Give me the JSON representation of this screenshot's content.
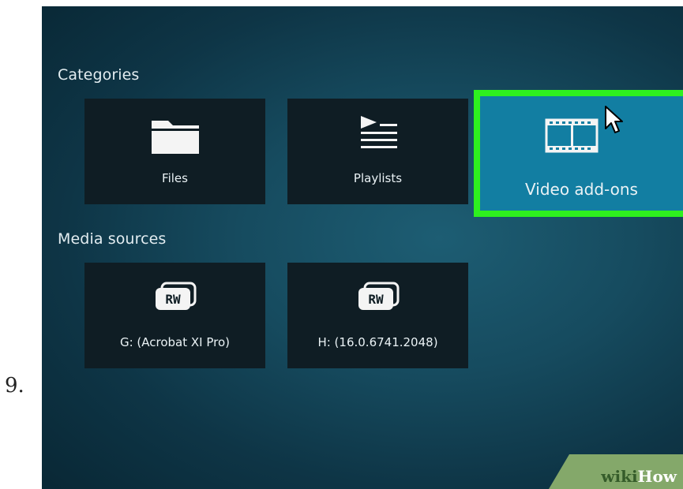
{
  "step": {
    "number": "9."
  },
  "categories": {
    "heading": "Categories",
    "tiles": [
      {
        "label": "Files",
        "icon": "folder-icon"
      },
      {
        "label": "Playlists",
        "icon": "playlist-icon"
      },
      {
        "label": "Video add-ons",
        "icon": "film-strip-icon",
        "state": "focused"
      }
    ]
  },
  "media_sources": {
    "heading": "Media sources",
    "tiles": [
      {
        "label": "G: (Acrobat XI Pro)",
        "icon": "rw-drive-icon",
        "icon_text": "RW"
      },
      {
        "label": "H: (16.0.6741.2048)",
        "icon": "rw-drive-icon",
        "icon_text": "RW"
      }
    ]
  },
  "watermark": {
    "wiki": "wiki",
    "how": "How"
  },
  "colors": {
    "highlight": "#2ef01f",
    "focused_tile": "#127ea2",
    "tile": "#0f1d24",
    "background": "#164b5f"
  }
}
